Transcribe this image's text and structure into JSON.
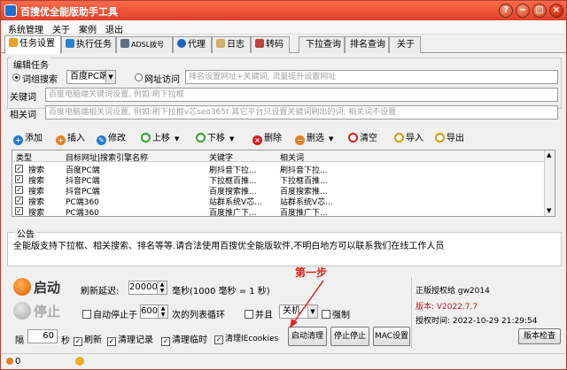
{
  "window": {
    "title": "百搜优全能版助手工具"
  },
  "menu": [
    "系统管理",
    "关于",
    "案例",
    "退出"
  ],
  "tabs": [
    "任务设置",
    "执行任务",
    "ADSL拨号",
    "代理",
    "日志",
    "转码",
    "下拉查询",
    "排名查询",
    "关于"
  ],
  "edit_group": {
    "title": "编辑任务",
    "radio_search": "词组搜索",
    "engine_select": "百度PC端",
    "radio_url": "网址访问",
    "url_placeholder": "排名设置网址+关键词, 流量提升设置网址",
    "keyword_label": "关键词",
    "keyword_placeholder": "百度电脑端关键词设置, 例如:刷下拉框",
    "related_label": "相关词",
    "related_placeholder": "百度电脑端相关词设置, 例如:刷下拉框v芯seo365t 其它平台只设置关键词刷出的词, 相关词不设置"
  },
  "toolbar": [
    "添加",
    "插入",
    "修改",
    "上移",
    "下移",
    "删除",
    "删选",
    "清空",
    "导入",
    "导出"
  ],
  "table": {
    "headers": [
      "类型",
      "目标网址|搜索引擎名称",
      "关键字",
      "相关词"
    ],
    "rows": [
      [
        "搜索",
        "百度PC端",
        "刷抖音下拉...",
        "刷抖音下拉..."
      ],
      [
        "搜索",
        "抖音PC端",
        "下拉框百推...",
        "下拉框百推..."
      ],
      [
        "搜索",
        "抖音PC端",
        "百度搜索推...",
        "百度搜索推..."
      ],
      [
        "搜索",
        "PC端360",
        "站群系统V芯...",
        "站群系统V芯..."
      ],
      [
        "搜索",
        "PC端360",
        "百度推广下...",
        "百度推广下..."
      ]
    ]
  },
  "notice": {
    "title": "公告",
    "text": "全能版支持下拉框、相关搜索、排名等等.请合法使用百搜优全能版软件,不明白地方可以联系我们在线工作人员"
  },
  "controls": {
    "start": "启动",
    "stop": "停止",
    "refresh_delay_label": "刷新延迟:",
    "refresh_delay_value": "20000",
    "ms_hint": "毫秒(1000 毫秒 = 1 秒)",
    "auto_stop_label": "自动停止于",
    "auto_stop_value": "6000",
    "loop_label": "次的列表循环",
    "and_label": "并且",
    "shutdown_select": "关机",
    "force_label": "强制",
    "interval_prefix": "隔",
    "interval_value": "60",
    "interval_unit": "秒",
    "cb_refresh": "刷新",
    "cb_clear_records": "清理记录",
    "cb_clear_temp": "清理临时",
    "cb_clear_cookies": "清理IEcookies",
    "btn_start_clean": "启动清理",
    "btn_stop_clean": "停止停止",
    "btn_mac": "MAC设置"
  },
  "license": {
    "authorized_to": "正版授权给 gw2014",
    "version": "版本: V2022.7.7",
    "auth_time": "授权时间: 2022-10-29 21:29:54",
    "check_button": "版本检查"
  },
  "annotation": "第一步",
  "status": {
    "left_value": "0"
  },
  "colors": {
    "titlebar": "#e0402a",
    "version_red": "#c02020",
    "annotation_red": "#e02020"
  }
}
